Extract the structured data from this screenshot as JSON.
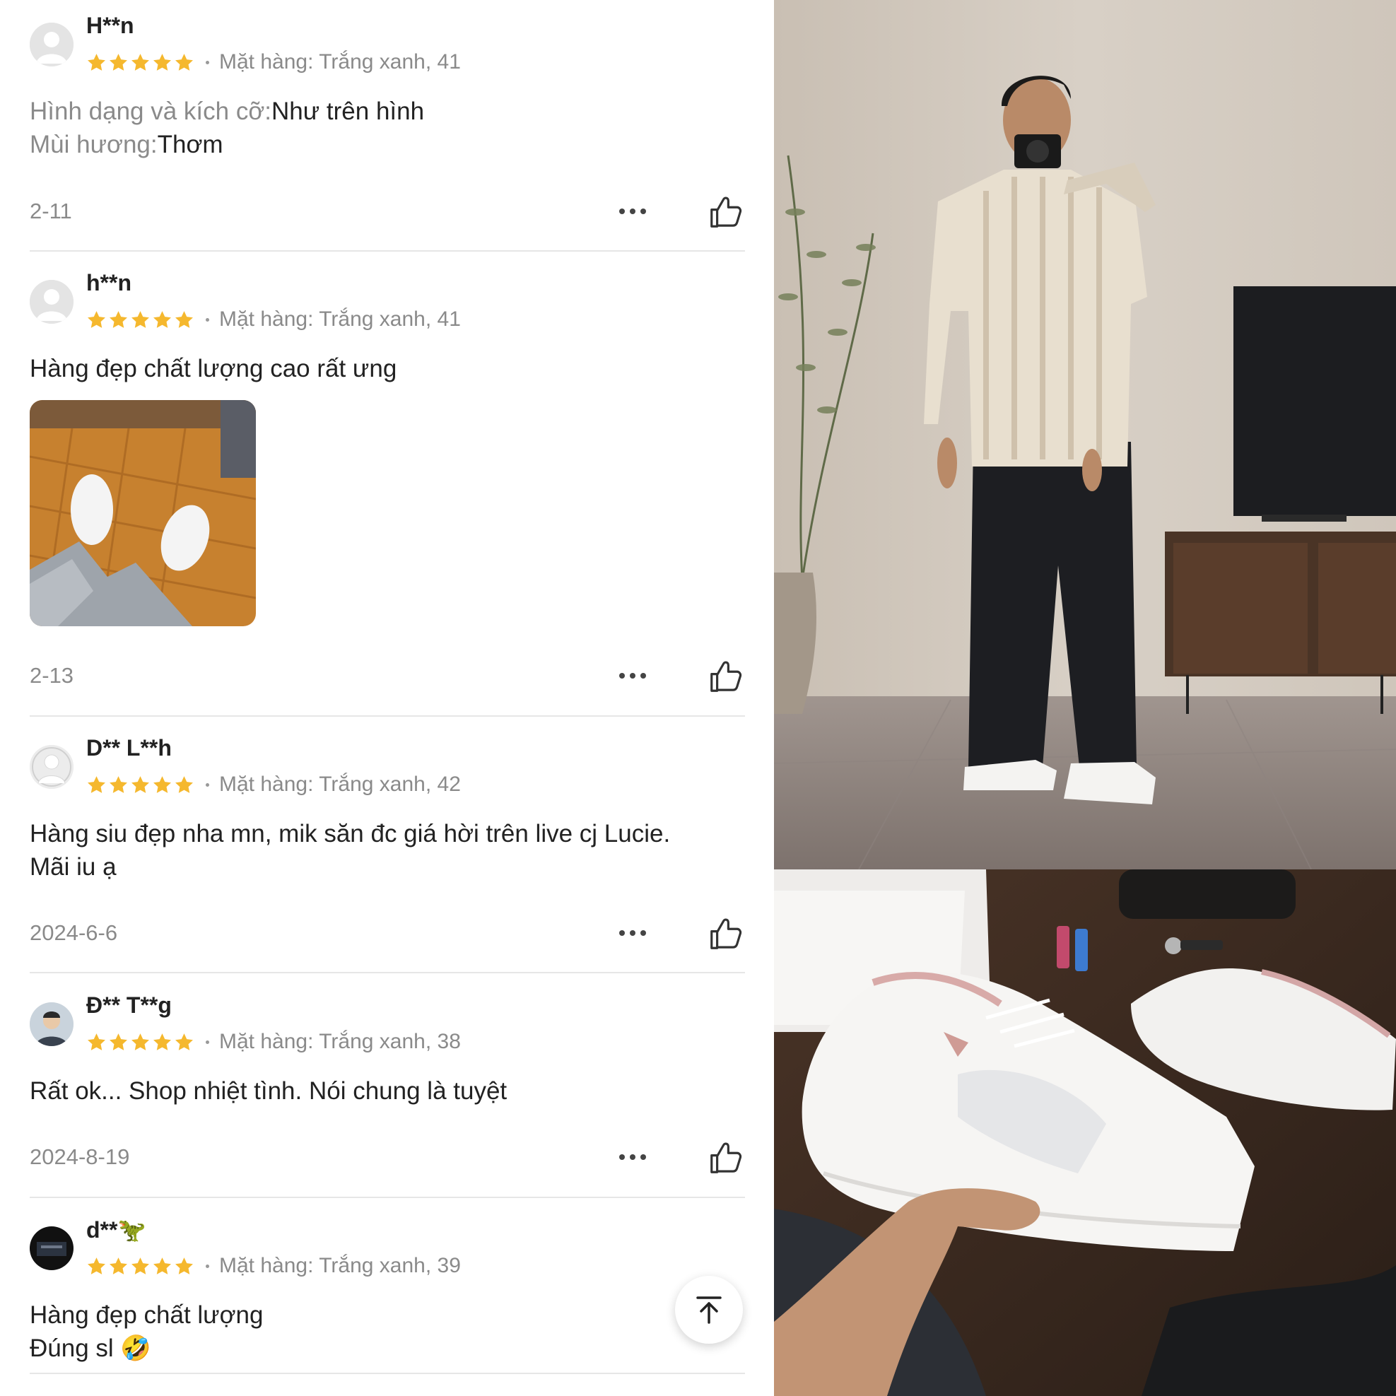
{
  "reviews": [
    {
      "username": "H**n",
      "stars": 5,
      "variant": "Mặt hàng: Trắng xanh, 41",
      "attributes": [
        {
          "label": "Hình dạng và kích cỡ:",
          "value": "Như trên hình"
        },
        {
          "label": "Mùi hương:",
          "value": "Thơm"
        }
      ],
      "date": "2-11"
    },
    {
      "username": "h**n",
      "stars": 5,
      "variant": "Mặt hàng: Trắng xanh, 41",
      "text": "Hàng đẹp chất lượng cao rất ưng",
      "date": "2-13"
    },
    {
      "username": "D** L**h",
      "stars": 5,
      "variant": "Mặt hàng: Trắng xanh, 42",
      "text_line1": "Hàng siu đẹp nha mn, mik săn đc giá hời trên live cj Lucie.",
      "text_line2": "Mãi iu ạ",
      "date": "2024-6-6"
    },
    {
      "username": "Đ** T**g",
      "stars": 5,
      "variant": "Mặt hàng: Trắng xanh, 38",
      "text": "Rất ok... Shop nhiệt tình. Nói chung là tuyệt",
      "date": "2024-8-19"
    },
    {
      "username": "d**🦖",
      "stars": 5,
      "variant": "Mặt hàng: Trắng xanh, 39",
      "text_line1": "Hàng đẹp chất lượng",
      "text_line2": "Đúng sl 🤣"
    }
  ],
  "colors": {
    "star": "#f5b82e",
    "muted_text": "#8a8a8a",
    "divider": "#e6e6e6"
  },
  "icons": {
    "star": "star-icon",
    "more": "more-dots-icon",
    "like": "thumbs-up-icon",
    "back_to_top": "arrow-up-to-line-icon"
  }
}
